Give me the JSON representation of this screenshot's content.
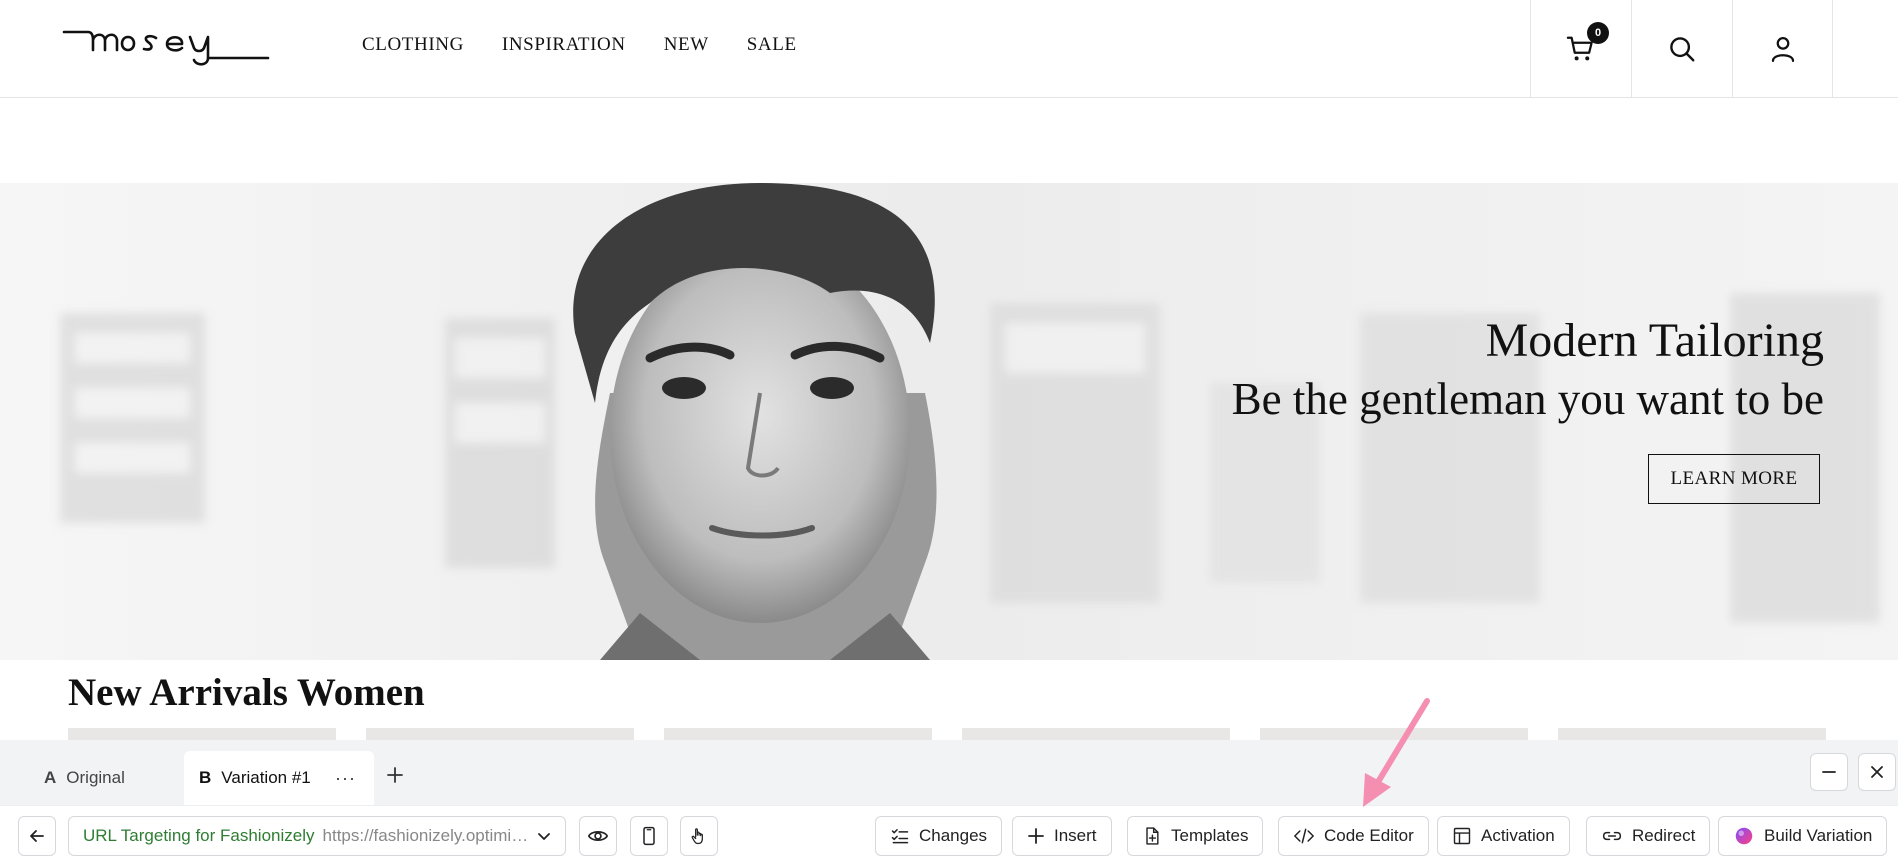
{
  "site": {
    "logo_text": "mosey",
    "nav": [
      "CLOTHING",
      "INSPIRATION",
      "NEW",
      "SALE"
    ],
    "cart_count": "0"
  },
  "hero": {
    "title": "Modern Tailoring",
    "subtitle": "Be the gentleman you want to be",
    "cta_label": "LEARN MORE"
  },
  "section": {
    "title": "New Arrivals Women",
    "product_count": 6
  },
  "editor": {
    "tabs": [
      {
        "letter": "A",
        "label": "Original"
      },
      {
        "letter": "B",
        "label": "Variation #1",
        "more": "···"
      }
    ],
    "targeting": {
      "label": "URL Targeting for Fashionizely",
      "url": "https://fashionizely.optimize"
    },
    "toolbar": {
      "changes": "Changes",
      "insert": "Insert",
      "templates": "Templates",
      "code_editor": "Code Editor",
      "activation": "Activation",
      "redirect": "Redirect",
      "build_variation": "Build Variation"
    },
    "colors": {
      "targeting_label": "#2e7d32",
      "annotation_arrow": "#f48fb1",
      "ai_gradient": [
        "#7c4dff",
        "#ff4081"
      ]
    }
  }
}
